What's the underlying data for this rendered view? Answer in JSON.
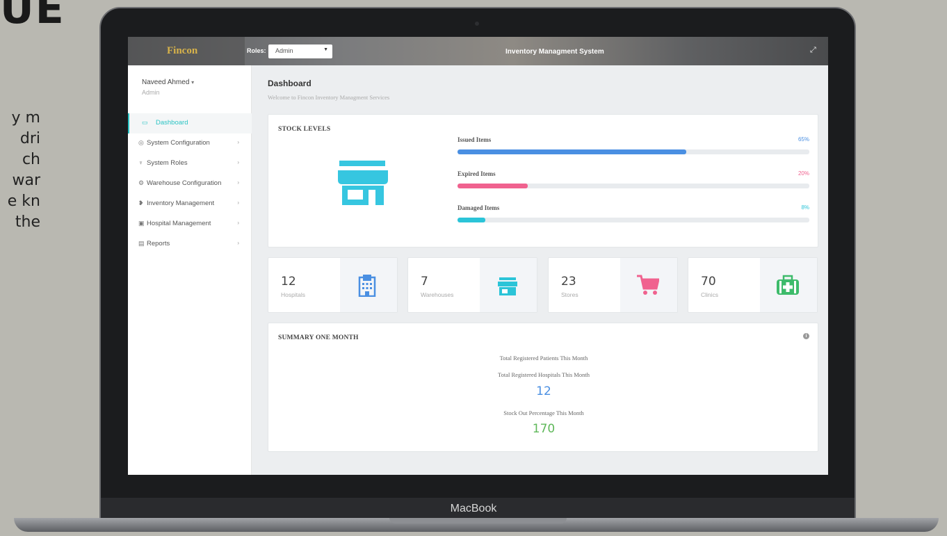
{
  "slide": {
    "heading_fragment": "UE",
    "text_fragments": [
      "y m",
      "dri",
      "ch",
      "war",
      "e kn",
      "the"
    ]
  },
  "laptop": {
    "brand": "MacBook"
  },
  "topbar": {
    "logo": "Fincon",
    "roles_label": "Roles:",
    "roles_value": "Admin",
    "app_title": "Inventory Managment System",
    "expand_icon": "expand-icon"
  },
  "sidebar": {
    "user_name": "Naveed Ahmed",
    "user_role": "Admin",
    "items": [
      {
        "label": "Dashboard",
        "icon": "monitor-icon"
      },
      {
        "label": "System Configuration",
        "icon": "globe-icon"
      },
      {
        "label": "System Roles",
        "icon": "pin-icon"
      },
      {
        "label": "Warehouse Configuration",
        "icon": "gear-icon"
      },
      {
        "label": "Inventory Management",
        "icon": "inventory-icon"
      },
      {
        "label": "Hospital Management",
        "icon": "hospital-icon"
      },
      {
        "label": "Reports",
        "icon": "report-icon"
      }
    ]
  },
  "main": {
    "title": "Dashboard",
    "subtitle": "Welcome to Fincon Inventory Managment Services"
  },
  "stock": {
    "title": "STOCK LEVELS",
    "bars": [
      {
        "label": "Issued Items",
        "pct_text": "65%",
        "value": 65,
        "color": "#4a8fe2"
      },
      {
        "label": "Expired Items",
        "pct_text": "20%",
        "value": 20,
        "color": "#f0628f"
      },
      {
        "label": "Damaged Items",
        "pct_text": "8%",
        "value": 8,
        "color": "#2bc4d8"
      }
    ]
  },
  "stats": [
    {
      "num": "12",
      "label": "Hospitals",
      "icon": "hospital-building-icon",
      "color": "#4a8fe2"
    },
    {
      "num": "7",
      "label": "Warehouses",
      "icon": "store-icon",
      "color": "#2bc4d8"
    },
    {
      "num": "23",
      "label": "Stores",
      "icon": "cart-icon",
      "color": "#f0628f"
    },
    {
      "num": "70",
      "label": "Clinics",
      "icon": "medkit-icon",
      "color": "#3dbb6b"
    }
  ],
  "summary": {
    "title": "SUMMARY ONE MONTH",
    "line1": "Total Registered Patients This Month",
    "line2": "Total Registered Hospitals This Month",
    "num1": "12",
    "line3": "Stock Out Percentage This Month",
    "num2": "170"
  }
}
